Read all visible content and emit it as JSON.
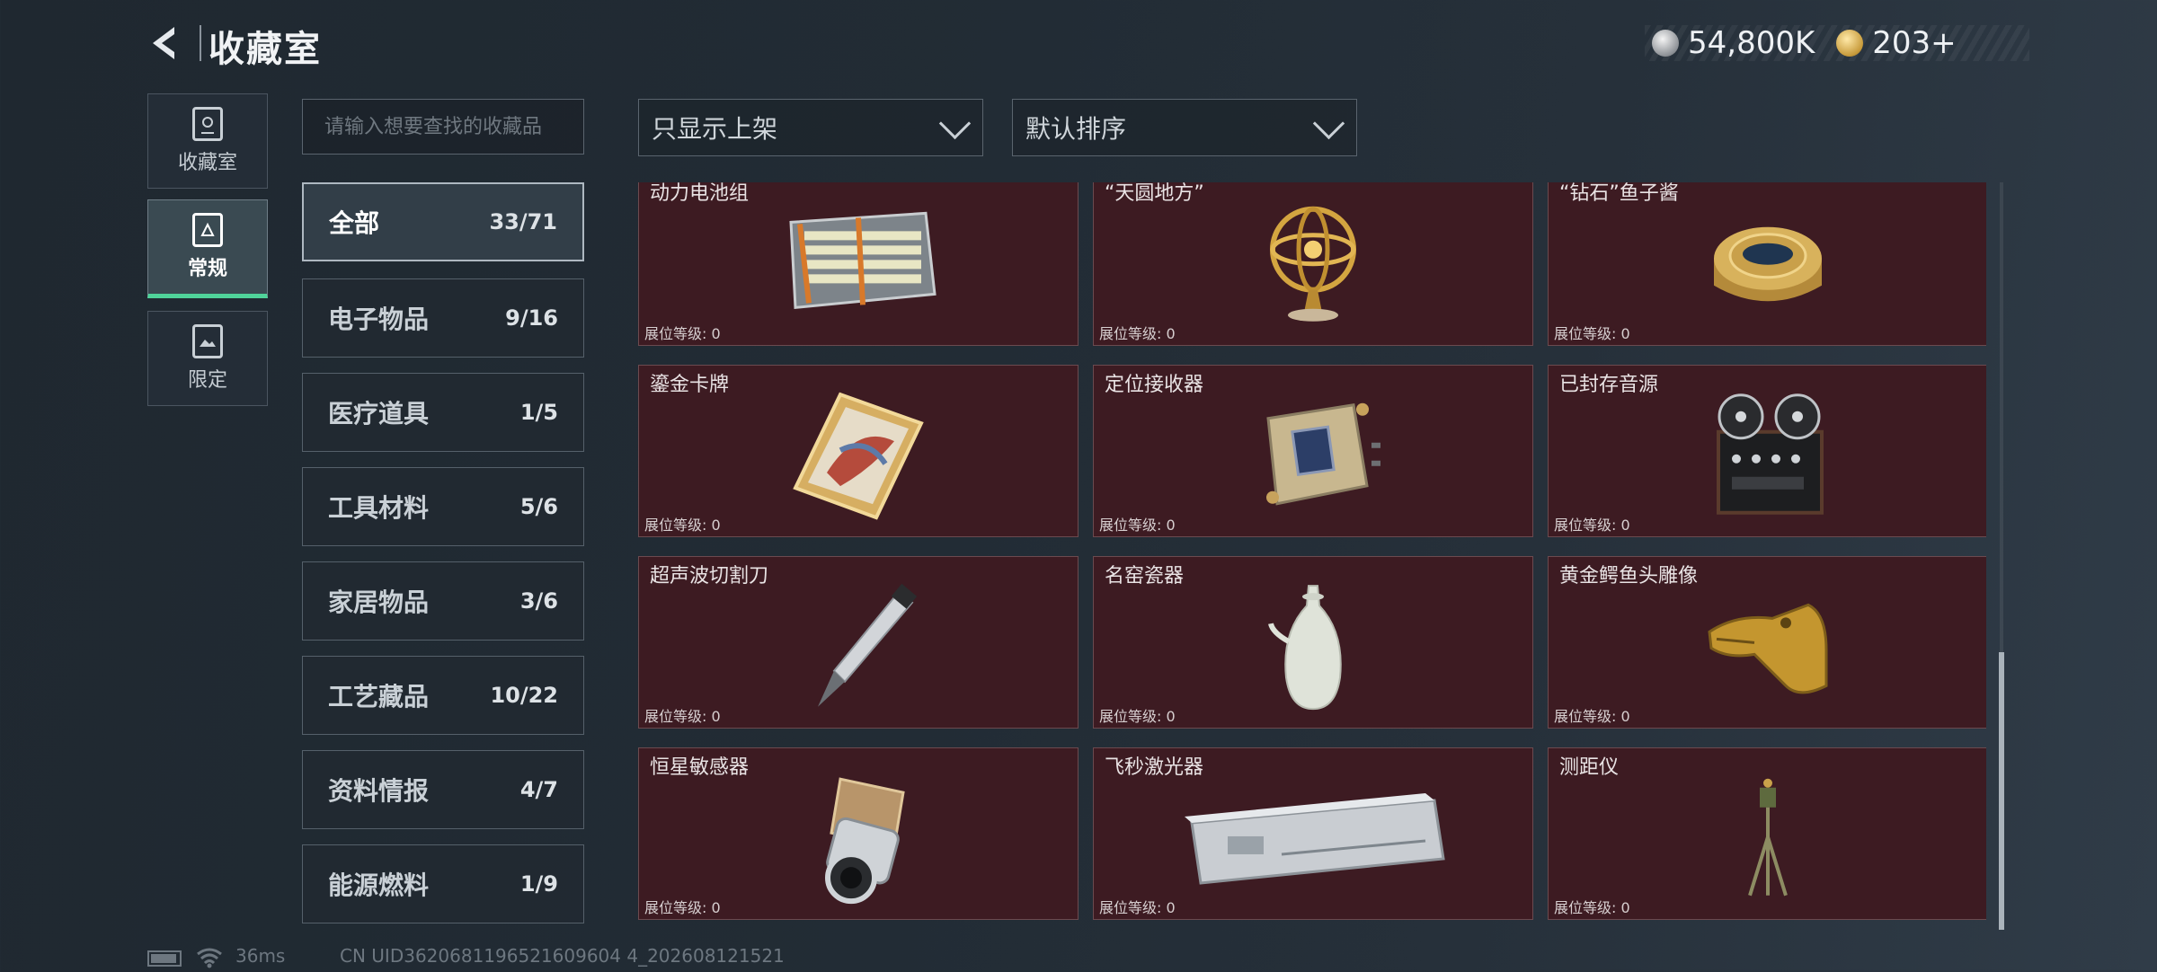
{
  "header": {
    "title": "收藏室",
    "back_icon": "back-arrow-icon",
    "currency": {
      "silver_value": "54,800K",
      "gold_value": "203+"
    }
  },
  "sidebar": {
    "items": [
      {
        "label": "收藏室",
        "icon": "collection-icon",
        "active": false
      },
      {
        "label": "常规",
        "icon": "document-icon",
        "active": true
      },
      {
        "label": "限定",
        "icon": "image-icon",
        "active": false
      }
    ]
  },
  "search": {
    "placeholder": "请输入想要查找的收藏品"
  },
  "categories": [
    {
      "name": "全部",
      "count": "33/71",
      "active": true
    },
    {
      "name": "电子物品",
      "count": "9/16"
    },
    {
      "name": "医疗道具",
      "count": "1/5"
    },
    {
      "name": "工具材料",
      "count": "5/6"
    },
    {
      "name": "家居物品",
      "count": "3/6"
    },
    {
      "name": "工艺藏品",
      "count": "10/22"
    },
    {
      "name": "资料情报",
      "count": "4/7"
    },
    {
      "name": "能源燃料",
      "count": "1/9"
    }
  ],
  "filters": {
    "show_filter": "只显示上架",
    "sort": "默认排序"
  },
  "items": [
    {
      "name": "动力电池组",
      "level": "展位等级: 0",
      "icon": "battery-pack-icon"
    },
    {
      "name": "“天圆地方”",
      "level": "展位等级: 0",
      "icon": "armillary-sphere-icon"
    },
    {
      "name": "“钻石”鱼子酱",
      "level": "展位等级: 0",
      "icon": "caviar-tin-icon"
    },
    {
      "name": "鎏金卡牌",
      "level": "展位等级: 0",
      "icon": "gilded-card-icon"
    },
    {
      "name": "定位接收器",
      "level": "展位等级: 0",
      "icon": "gps-receiver-icon"
    },
    {
      "name": "已封存音源",
      "level": "展位等级: 0",
      "icon": "reel-recorder-icon"
    },
    {
      "name": "超声波切割刀",
      "level": "展位等级: 0",
      "icon": "ultrasonic-cutter-icon"
    },
    {
      "name": "名窑瓷器",
      "level": "展位等级: 0",
      "icon": "porcelain-vase-icon"
    },
    {
      "name": "黄金鳄鱼头雕像",
      "level": "展位等级: 0",
      "icon": "gold-crocodile-head-icon"
    },
    {
      "name": "恒星敏感器",
      "level": "展位等级: 0",
      "icon": "star-sensor-icon"
    },
    {
      "name": "飞秒激光器",
      "level": "展位等级: 0",
      "icon": "femtosecond-laser-icon"
    },
    {
      "name": "测距仪",
      "level": "展位等级: 0",
      "icon": "rangefinder-tripod-icon"
    }
  ],
  "status": {
    "ping": "36ms",
    "uid": "CN UID3620681196521609604 4_202608121521"
  }
}
